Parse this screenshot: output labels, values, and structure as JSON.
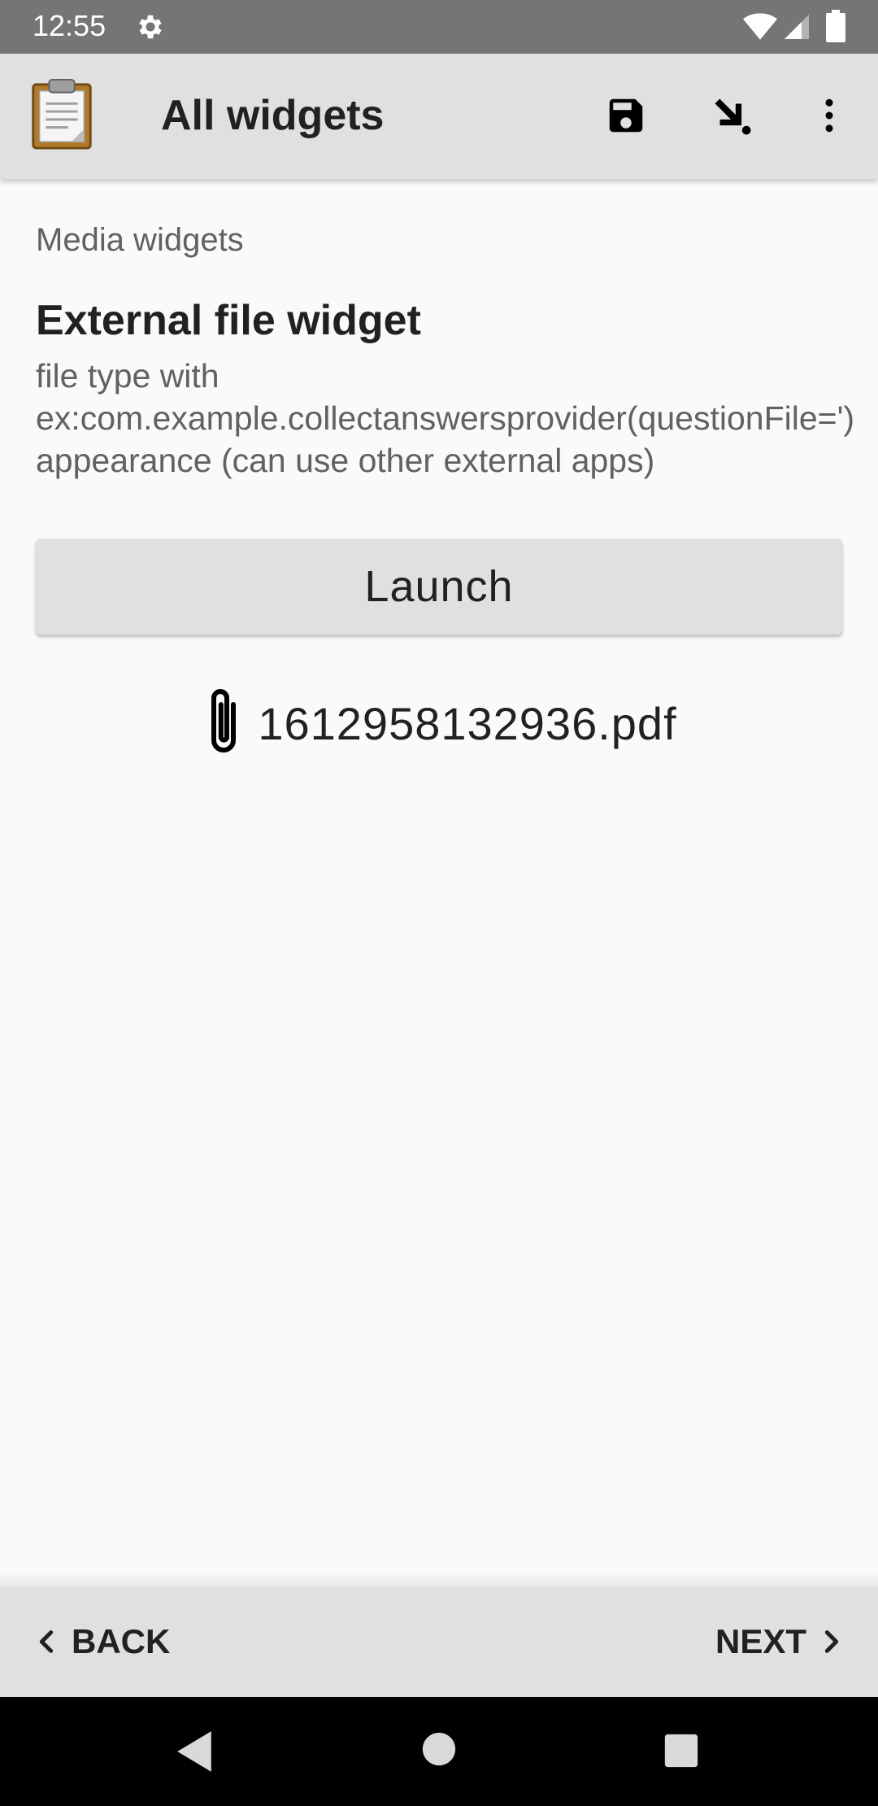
{
  "status_bar": {
    "time": "12:55",
    "icons": [
      "gear-icon",
      "wifi-icon",
      "signal-icon",
      "battery-icon"
    ]
  },
  "toolbar": {
    "title": "All widgets",
    "app_icon": "clipboard-icon",
    "actions": [
      "save-icon",
      "jump-arrow-icon",
      "more-vert-icon"
    ]
  },
  "content": {
    "group_label": "Media widgets",
    "question_title": "External file widget",
    "question_hint": "file type with ex:com.example.collectanswersprovider(questionFile=') appearance (can use other external apps)",
    "launch_label": "Launch",
    "file_name": "1612958132936.pdf",
    "file_icon": "paperclip-icon"
  },
  "bottom_nav": {
    "back_label": "BACK",
    "next_label": "NEXT"
  },
  "system_nav": {
    "icons": [
      "back-triangle-icon",
      "home-circle-icon",
      "recents-square-icon"
    ]
  },
  "colors": {
    "status_bar": "#757575",
    "toolbar": "#e0e0e0",
    "background": "#fafafa",
    "text_primary": "#212121",
    "text_secondary": "#616161"
  }
}
